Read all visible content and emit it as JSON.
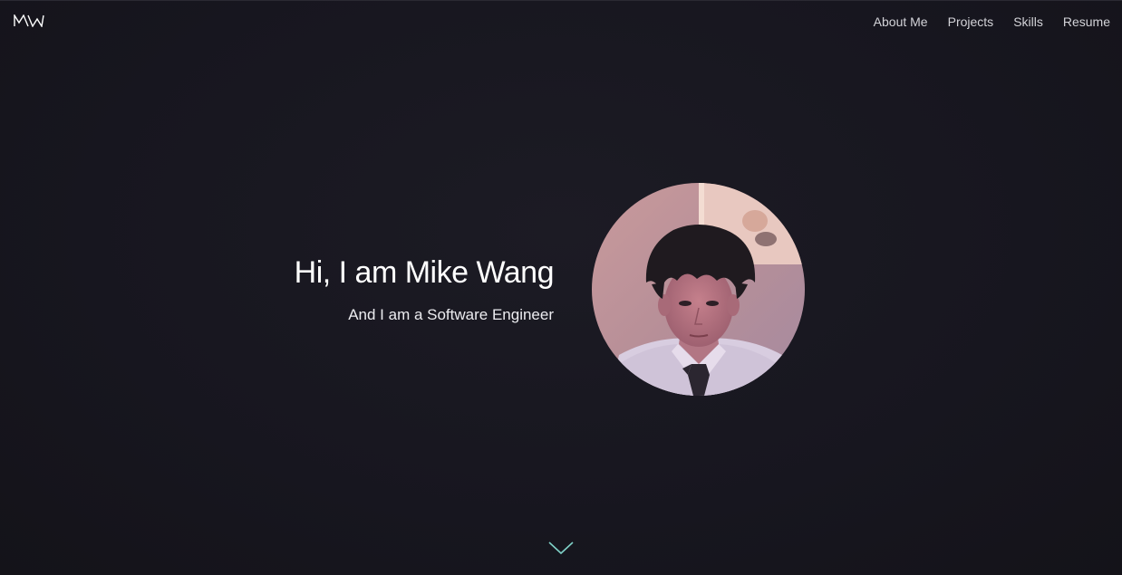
{
  "brand": {
    "logo_icon": "mw-monogram-logo"
  },
  "nav": {
    "items": [
      {
        "label": "About Me"
      },
      {
        "label": "Projects"
      },
      {
        "label": "Skills"
      },
      {
        "label": "Resume"
      }
    ]
  },
  "hero": {
    "title": "Hi, I am Mike Wang",
    "subtitle": "And I am a Software Engineer",
    "avatar_icon": "profile-photo"
  },
  "scroll_indicator": {
    "icon": "chevron-down-icon",
    "color": "#7fd1c7"
  },
  "colors": {
    "background": "#17161f",
    "nav_text": "#d3d3d8",
    "accent": "#7fd1c7"
  }
}
